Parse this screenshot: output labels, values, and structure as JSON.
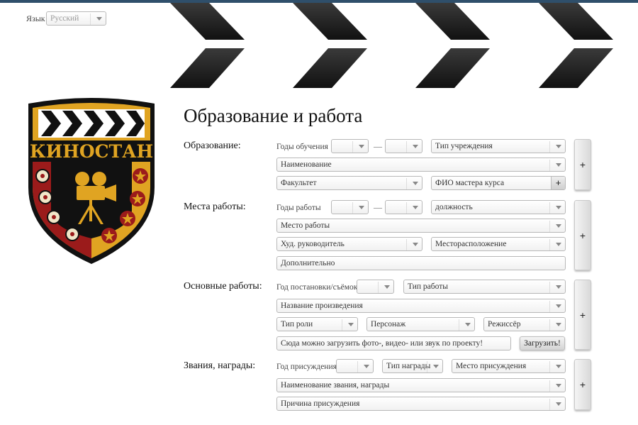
{
  "language": {
    "label": "Язык",
    "value": "Русский"
  },
  "page": {
    "title": "Образование и работа"
  },
  "logo": {
    "text": "КИНОСТАН"
  },
  "education": {
    "label": "Образование:",
    "years_label": "Годы обучения",
    "year_from": "",
    "year_to": "",
    "institution_type": "Тип учреждения",
    "name": "Наименование",
    "faculty": "Факультет",
    "master": "ФИО мастера курса",
    "add": "+"
  },
  "work": {
    "label": "Места работы:",
    "years_label": "Годы работы",
    "year_from": "",
    "year_to": "",
    "position": "должность",
    "place": "Место работы",
    "director": "Худ. руководитель",
    "location": "Месторасположение",
    "extra": "Дополнительно",
    "add": "+"
  },
  "projects": {
    "label": "Основные работы:",
    "year_label": "Год постановки/съёмок",
    "year": "",
    "work_type": "Тип работы",
    "title": "Название произведения",
    "role_type": "Тип роли",
    "character": "Персонаж",
    "director": "Режиссёр",
    "upload_placeholder": "Сюда можно загрузить фото-, видео- или звук по проекту!",
    "upload_button": "Загрузить!",
    "add": "+"
  },
  "awards": {
    "label": "Звания, награды:",
    "year_label": "Год присуждения",
    "year": "",
    "award_type": "Тип награды",
    "place": "Место присуждения",
    "name": "Наименование звания, награды",
    "reason": "Причина присуждения",
    "add": "+"
  },
  "dash": "—",
  "colors": {
    "topbar": "#2f4f6b",
    "clapper": "#1c1c1c",
    "logo_gold": "#e0a422",
    "logo_red": "#9b1b1b"
  }
}
